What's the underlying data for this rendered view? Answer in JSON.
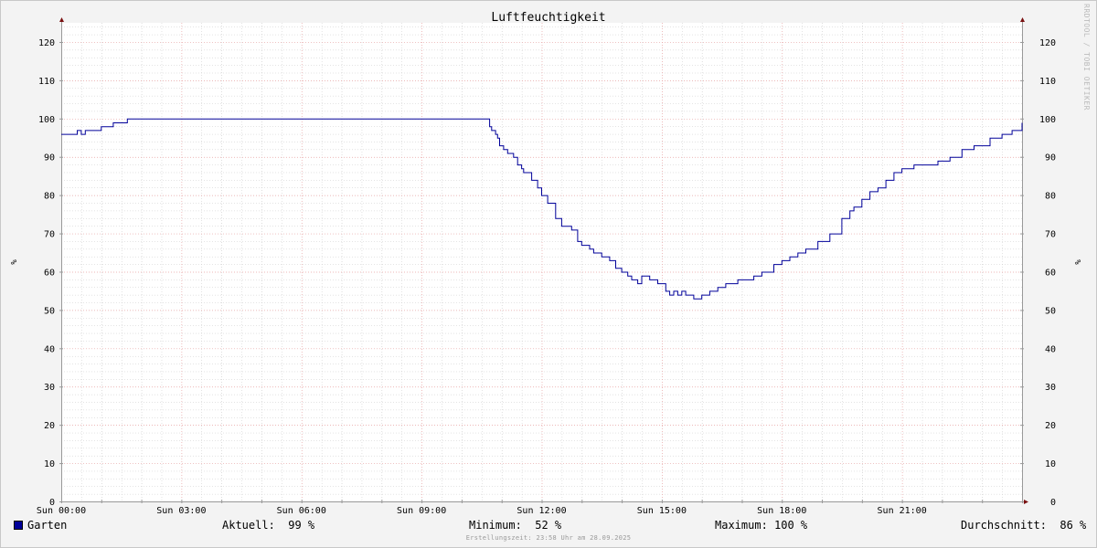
{
  "chart_data": {
    "type": "line",
    "title": "Luftfeuchtigkeit",
    "ylabel": "%",
    "ylim": [
      0,
      125
    ],
    "yticks": [
      0,
      10,
      20,
      30,
      40,
      50,
      60,
      70,
      80,
      90,
      100,
      110,
      120
    ],
    "xlim_hours": [
      0,
      24
    ],
    "xtick_labels": [
      "Sun 00:00",
      "Sun 03:00",
      "Sun 06:00",
      "Sun 09:00",
      "Sun 12:00",
      "Sun 15:00",
      "Sun 18:00",
      "Sun 21:00"
    ],
    "grid": true,
    "series": [
      {
        "name": "Garten",
        "color": "#000099",
        "x_hours": [
          0,
          0.35,
          0.4,
          0.5,
          0.55,
          0.6,
          0.9,
          1.0,
          1.2,
          1.3,
          1.6,
          1.65,
          10.6,
          10.7,
          10.75,
          10.85,
          10.9,
          10.95,
          11.05,
          11.15,
          11.3,
          11.4,
          11.5,
          11.55,
          11.6,
          11.75,
          11.9,
          12.0,
          12.15,
          12.35,
          12.5,
          12.65,
          12.75,
          12.9,
          13.0,
          13.2,
          13.3,
          13.5,
          13.7,
          13.85,
          14.0,
          14.15,
          14.25,
          14.4,
          14.5,
          14.7,
          14.9,
          15.0,
          15.1,
          15.2,
          15.3,
          15.4,
          15.5,
          15.6,
          15.7,
          15.8,
          15.9,
          16.0,
          16.1,
          16.2,
          16.4,
          16.6,
          16.9,
          17.0,
          17.3,
          17.5,
          17.8,
          18.0,
          18.2,
          18.4,
          18.6,
          18.9,
          19.2,
          19.5,
          19.7,
          19.8,
          20.0,
          20.2,
          20.4,
          20.6,
          20.8,
          21.0,
          21.3,
          21.6,
          21.9,
          22.2,
          22.5,
          22.8,
          23.2,
          23.5,
          23.75,
          24.0
        ],
        "values": [
          96,
          96,
          97,
          96,
          96,
          97,
          97,
          98,
          98,
          99,
          99,
          100,
          100,
          98,
          97,
          96,
          95,
          93,
          92,
          91,
          90,
          88,
          87,
          86,
          86,
          84,
          82,
          80,
          78,
          74,
          72,
          72,
          71,
          68,
          67,
          66,
          65,
          64,
          63,
          61,
          60,
          59,
          58,
          57,
          59,
          58,
          57,
          57,
          55,
          54,
          55,
          54,
          55,
          54,
          54,
          53,
          53,
          54,
          54,
          55,
          56,
          57,
          58,
          58,
          59,
          60,
          62,
          63,
          64,
          65,
          66,
          68,
          70,
          74,
          76,
          77,
          79,
          81,
          82,
          84,
          86,
          87,
          88,
          88,
          89,
          90,
          92,
          93,
          95,
          96,
          97,
          99
        ]
      }
    ]
  },
  "legend": {
    "series_name": "Garten",
    "current_label": "Aktuell:",
    "current_value": "99 %",
    "min_label": "Minimum:",
    "min_value": "52 %",
    "max_label": "Maximum:",
    "max_value": "100 %",
    "avg_label": "Durchschnitt:",
    "avg_value": "86 %"
  },
  "footer": "Erstellungszeit: 23:58 Uhr am 28.09.2025",
  "watermark": "RRDTOOL / TOBI OETIKER",
  "colors": {
    "line": "#000099",
    "major_grid": "#e6a0a0",
    "minor_grid": "#c8c8c8",
    "axis": "#999999",
    "arrow": "#7a1010"
  }
}
